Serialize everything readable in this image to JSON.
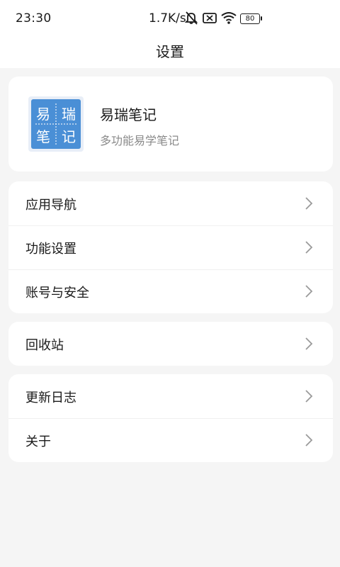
{
  "status_bar": {
    "time": "23:30",
    "net_speed": "1.7K/s",
    "battery": "80",
    "icons": [
      "bell-muted-icon",
      "sim-x-icon",
      "wifi-icon",
      "battery-icon"
    ]
  },
  "header": {
    "title": "设置"
  },
  "profile": {
    "logo_chars": [
      "易",
      "瑞",
      "笔",
      "记"
    ],
    "app_name": "易瑞笔记",
    "app_desc": "多功能易学笔记"
  },
  "groups": [
    {
      "items": [
        {
          "label": "应用导航"
        },
        {
          "label": "功能设置"
        },
        {
          "label": "账号与安全"
        }
      ]
    },
    {
      "items": [
        {
          "label": "回收站"
        }
      ]
    },
    {
      "items": [
        {
          "label": "更新日志"
        },
        {
          "label": "关于"
        }
      ]
    }
  ],
  "colors": {
    "background": "#f5f5f5",
    "card": "#ffffff",
    "logo_blue": "#4a8fd6"
  }
}
